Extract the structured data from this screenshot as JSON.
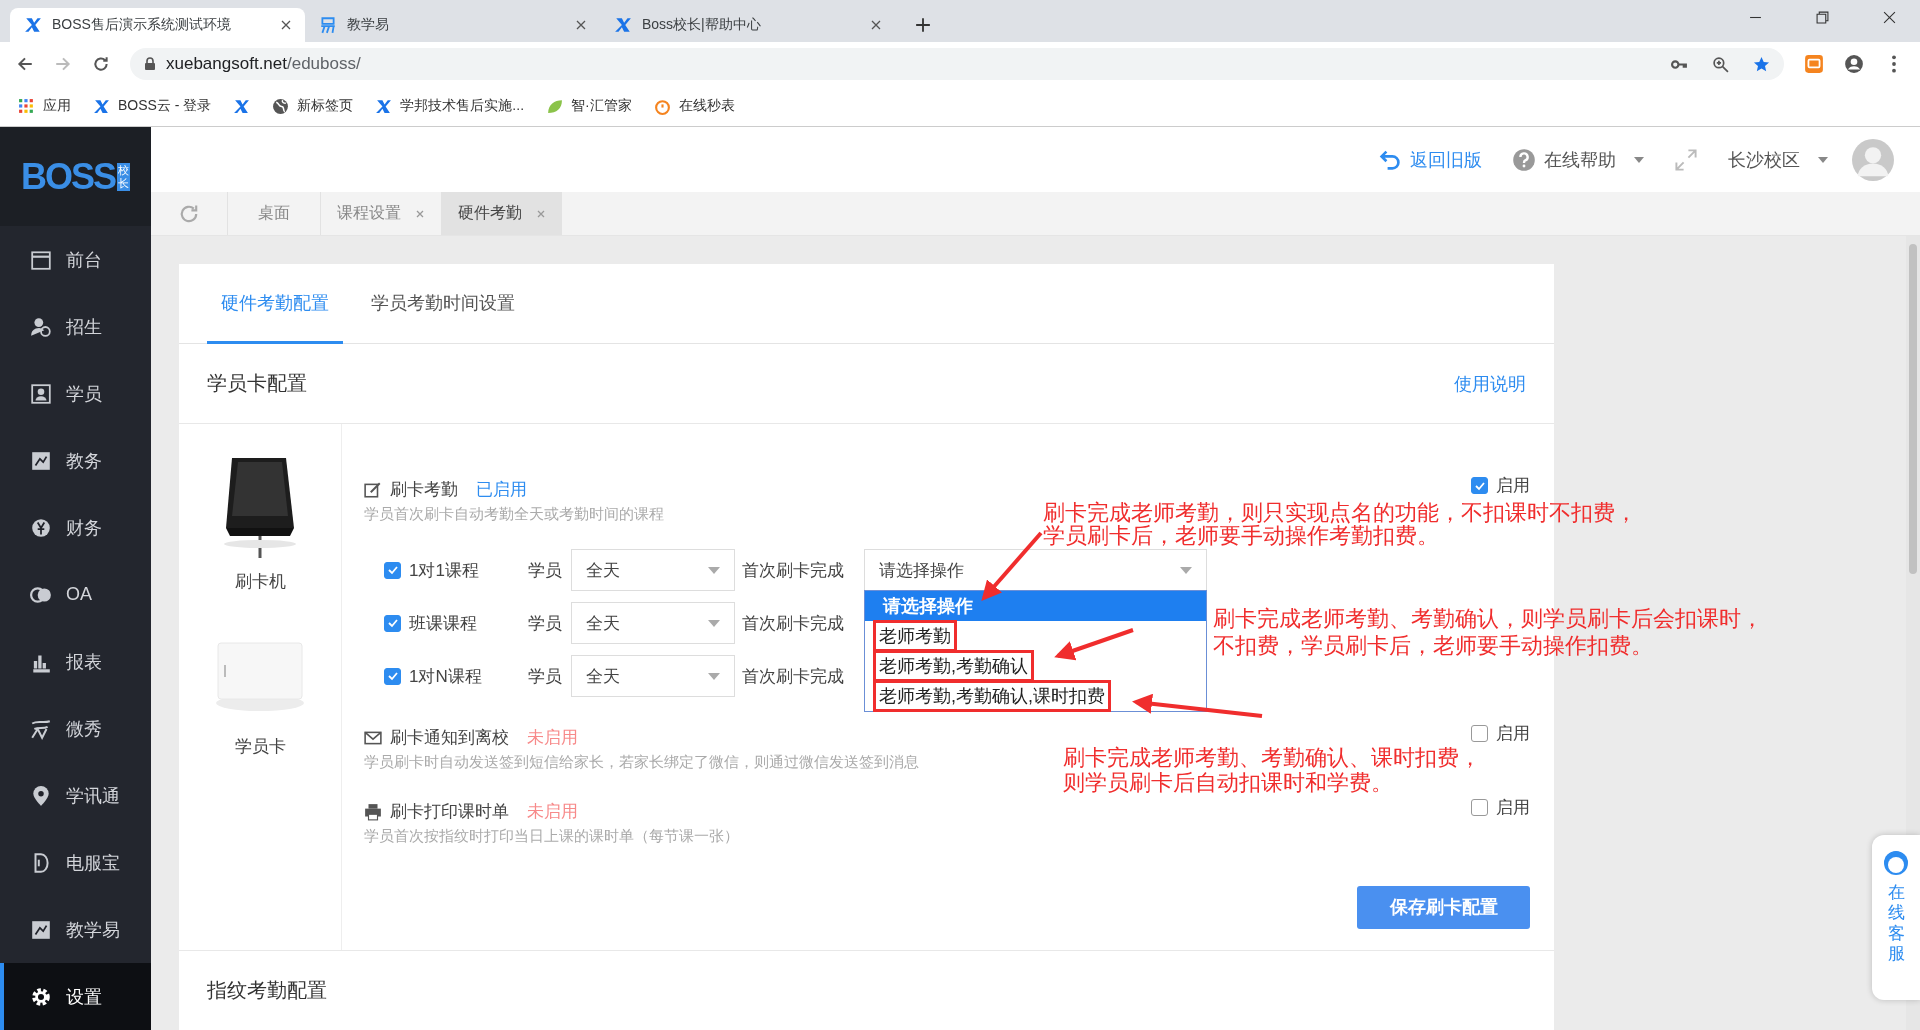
{
  "browser": {
    "tabs": [
      {
        "kind": "x",
        "title": "BOSS售后演示系统测试环境",
        "selected": true
      },
      {
        "kind": "yi",
        "title": "教学易",
        "selected": false
      },
      {
        "kind": "x",
        "title": "Boss校长|帮助中心",
        "selected": false
      }
    ],
    "url_host": "xuebangsoft.net",
    "url_path": "/eduboss/",
    "bookmarks": [
      {
        "kind": "apps",
        "label": "应用"
      },
      {
        "kind": "x",
        "label": "BOSS云 - 登录"
      },
      {
        "kind": "x"
      },
      {
        "kind": "globe",
        "label": "新标签页"
      },
      {
        "kind": "x",
        "label": "学邦技术售后实施..."
      },
      {
        "kind": "leaf",
        "label": "智·汇管家"
      },
      {
        "kind": "timer",
        "label": "在线秒表"
      }
    ]
  },
  "logo": {
    "text": "BOSS",
    "sub": "校长"
  },
  "sidebar": {
    "items": [
      {
        "label": "前台",
        "selected": false
      },
      {
        "label": "招生",
        "selected": false
      },
      {
        "label": "学员",
        "selected": false
      },
      {
        "label": "教务",
        "selected": false
      },
      {
        "label": "财务",
        "selected": false
      },
      {
        "label": "OA",
        "selected": false
      },
      {
        "label": "报表",
        "selected": false
      },
      {
        "label": "微秀",
        "selected": false
      },
      {
        "label": "学讯通",
        "selected": false
      },
      {
        "label": "电服宝",
        "selected": false
      },
      {
        "label": "教学易",
        "selected": false
      },
      {
        "label": "设置",
        "selected": true
      }
    ]
  },
  "header": {
    "back": "返回旧版",
    "help": "在线帮助",
    "campus": "长沙校区"
  },
  "page_tabs": [
    {
      "label": "桌面",
      "closable": false,
      "selected": false
    },
    {
      "label": "课程设置",
      "closable": true,
      "selected": false
    },
    {
      "label": "硬件考勤",
      "closable": true,
      "selected": true
    }
  ],
  "card_tabs": [
    {
      "label": "硬件考勤配置",
      "selected": true
    },
    {
      "label": "学员考勤时间设置",
      "selected": false
    }
  ],
  "section": {
    "title": "学员卡配置",
    "link": "使用说明"
  },
  "devices": [
    {
      "kind": "reader",
      "label": "刷卡机"
    },
    {
      "kind": "card",
      "label": "学员卡"
    }
  ],
  "features": [
    {
      "kind": "edit",
      "title": "刷卡考勤",
      "active": true,
      "status": "已启用",
      "description": "学员首次刷卡自动考勤全天或考勤时间的课程",
      "enable_label": "启用",
      "checked": true,
      "courses": [
        {
          "label": "1对1课程",
          "checked": true,
          "student_label": "学员",
          "period": "全天",
          "first_label": "首次刷卡完成",
          "action": "请选择操作"
        },
        {
          "label": "班课课程",
          "checked": true,
          "student_label": "学员",
          "period": "全天",
          "first_label": "首次刷卡完成"
        },
        {
          "label": "1对N课程",
          "checked": true,
          "student_label": "学员",
          "period": "全天",
          "first_label": "首次刷卡完成"
        }
      ]
    },
    {
      "kind": "mail",
      "title": "刷卡通知到离校",
      "active": false,
      "status": "未启用",
      "description": "学员刷卡时自动发送签到短信给家长，若家长绑定了微信，则通过微信发送签到消息",
      "enable_label": "启用",
      "checked": false
    },
    {
      "kind": "print",
      "title": "刷卡打印课时单",
      "active": false,
      "status": "未启用",
      "description": "学员首次按指纹时打印当日上课的课时单（每节课一张）",
      "enable_label": "启用",
      "checked": false
    }
  ],
  "dropdown": {
    "options": [
      {
        "label": "请选择操作",
        "selected": true,
        "marked": false
      },
      {
        "label": "老师考勤",
        "selected": false,
        "marked": true
      },
      {
        "label": "老师考勤,考勤确认",
        "selected": false,
        "marked": true
      },
      {
        "label": "老师考勤,考勤确认,课时扣费",
        "selected": false,
        "marked": true
      }
    ]
  },
  "save_button": "保存刷卡配置",
  "next_section": "指纹考勤配置",
  "online_service": "在线客服",
  "annotations": [
    {
      "lines": [
        "刷卡完成老师考勤，则只实现点名的功能，不扣课时不扣费，",
        "学员刷卡后，老师要手动操作考勤扣费。"
      ]
    },
    {
      "lines": [
        "刷卡完成老师考勤、考勤确认，则学员刷卡后会扣课时，",
        "不扣费，学员刷卡后，老师要手动操作扣费。"
      ]
    },
    {
      "lines": [
        "刷卡完成老师考勤、考勤确认、课时扣费，",
        "则学员刷卡后自动扣课时和学费。"
      ]
    }
  ]
}
